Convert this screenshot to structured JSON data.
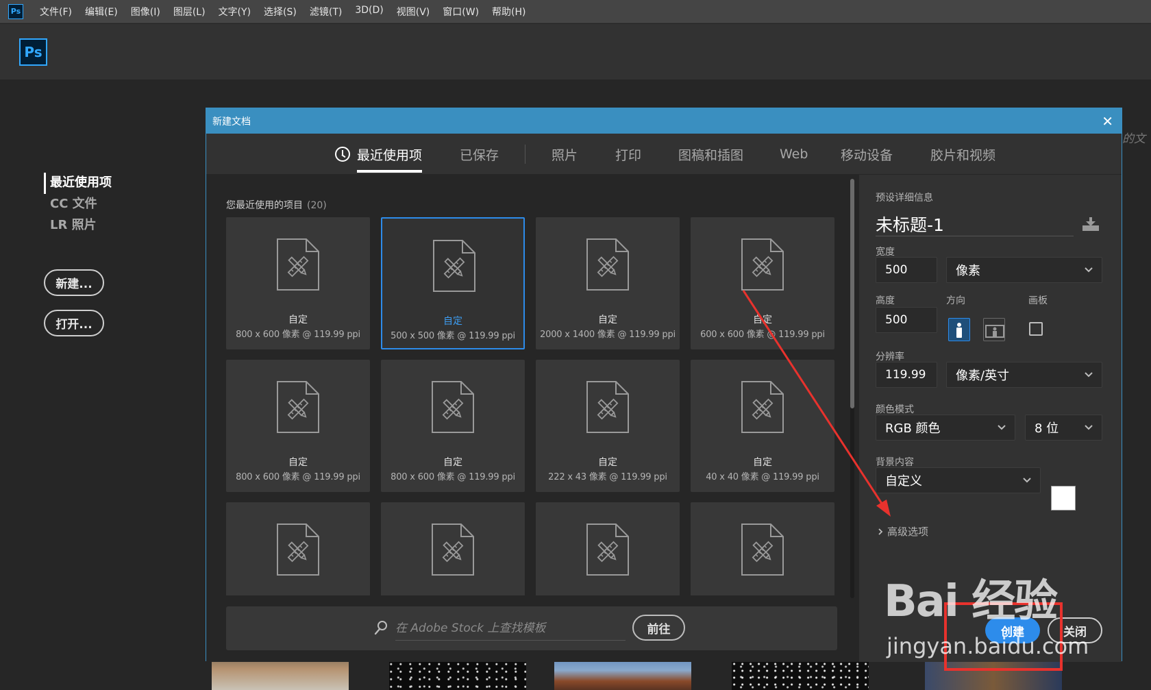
{
  "menubar": {
    "app_icon": "Ps",
    "items": [
      "文件(F)",
      "编辑(E)",
      "图像(I)",
      "图层(L)",
      "文字(Y)",
      "选择(S)",
      "滤镜(T)",
      "3D(D)",
      "视图(V)",
      "窗口(W)",
      "帮助(H)"
    ]
  },
  "appbar": {
    "logo": "Ps"
  },
  "home": {
    "nav": [
      "最近使用项",
      "CC 文件",
      "LR 照片"
    ],
    "new_button": "新建...",
    "open_button": "打开..."
  },
  "background_edge_text": "的文",
  "dialog": {
    "title": "新建文档",
    "close_glyph": "✕",
    "tabs": [
      "最近使用项",
      "已保存",
      "照片",
      "打印",
      "图稿和插图",
      "Web",
      "移动设备",
      "胶片和视频"
    ],
    "active_tab": "最近使用项",
    "recent": {
      "heading": "您最近使用的项目",
      "count": "(20)",
      "items": [
        {
          "name": "自定",
          "spec": "800 x 600 像素 @ 119.99 ppi"
        },
        {
          "name": "自定",
          "spec": "500 x 500 像素 @ 119.99 ppi",
          "selected": true
        },
        {
          "name": "自定",
          "spec": "2000 x 1400 像素 @ 119.99 ppi"
        },
        {
          "name": "自定",
          "spec": "600 x 600 像素 @ 119.99 ppi"
        },
        {
          "name": "自定",
          "spec": "800 x 600 像素 @ 119.99 ppi"
        },
        {
          "name": "自定",
          "spec": "800 x 600 像素 @ 119.99 ppi"
        },
        {
          "name": "自定",
          "spec": "222 x 43 像素 @ 119.99 ppi"
        },
        {
          "name": "自定",
          "spec": "40 x 40 像素 @ 119.99 ppi"
        },
        {
          "name": "",
          "spec": ""
        },
        {
          "name": "",
          "spec": ""
        },
        {
          "name": "",
          "spec": ""
        },
        {
          "name": "",
          "spec": ""
        }
      ]
    },
    "stock": {
      "placeholder": "在 Adobe Stock 上查找模板",
      "go_button": "前往"
    },
    "details": {
      "section_label": "预设详细信息",
      "doc_name": "未标题-1",
      "width_label": "宽度",
      "width_value": "500",
      "width_unit": "像素",
      "height_label": "高度",
      "height_value": "500",
      "orientation_label": "方向",
      "orientation": "portrait",
      "artboard_label": "画板",
      "artboard_checked": false,
      "resolution_label": "分辨率",
      "resolution_value": "119.99",
      "resolution_unit": "像素/英寸",
      "color_mode_label": "颜色模式",
      "color_mode": "RGB 颜色",
      "bit_depth": "8 位",
      "background_label": "背景内容",
      "background": "自定义",
      "background_color": "#ffffff",
      "advanced": "高级选项",
      "create_button": "创建",
      "close_button": "关闭"
    }
  },
  "colors": {
    "accent": "#2d8ceb",
    "title_bar": "#3a8fc0",
    "annotation": "#e8322d"
  },
  "watermark": {
    "line1": "Bai 经验",
    "line2": "jingyan.baidu.com"
  }
}
